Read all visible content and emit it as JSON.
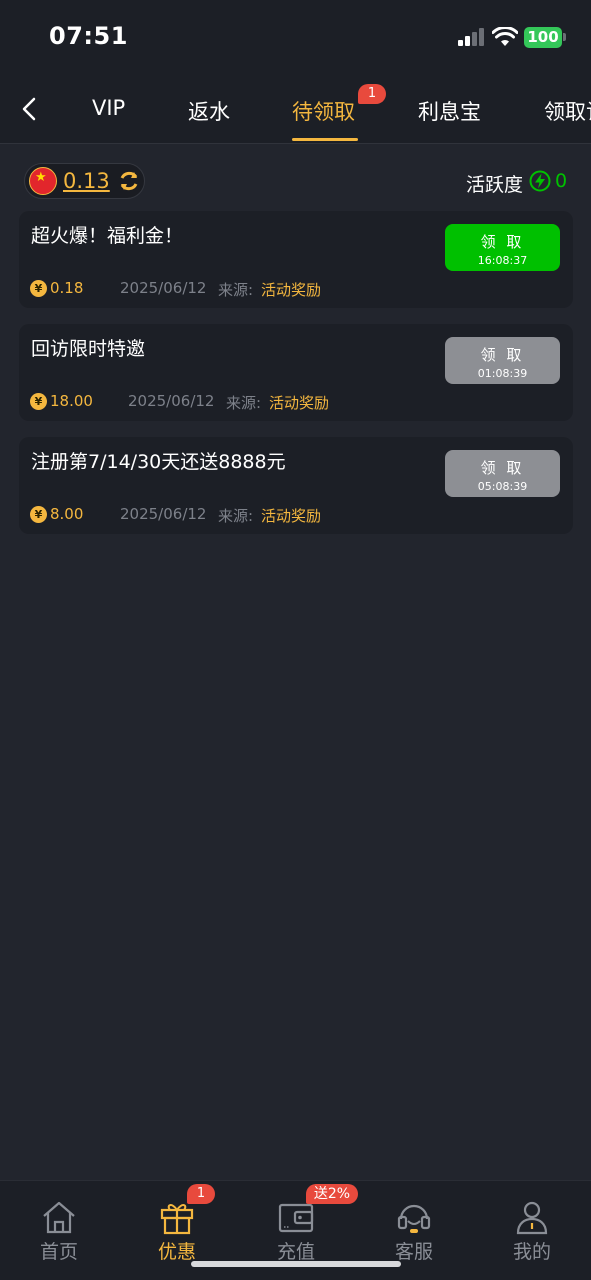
{
  "status_bar": {
    "time": "07:51",
    "battery": "100"
  },
  "nav": {
    "tabs": [
      {
        "label": "VIP"
      },
      {
        "label": "返水"
      },
      {
        "label": "待领取",
        "badge": "1"
      },
      {
        "label": "利息宝"
      },
      {
        "label": "领取记录"
      }
    ],
    "active_tab": "待领取"
  },
  "balance": {
    "amount": "0.13"
  },
  "activity": {
    "label": "活跃度",
    "value": "0"
  },
  "rewards": [
    {
      "title": "超火爆！福利金！",
      "amount": "0.18",
      "date": "2025/06/12",
      "source_label": "来源:",
      "source": "活动奖励",
      "button_label": "领 取",
      "countdown": "16:08:37",
      "state": "active"
    },
    {
      "title": "回访限时特邀",
      "amount": "18.00",
      "date": "2025/06/12",
      "source_label": "来源:",
      "source": "活动奖励",
      "button_label": "领 取",
      "countdown": "01:08:39",
      "state": "disabled"
    },
    {
      "title": "注册第7/14/30天还送8888元",
      "amount": "8.00",
      "date": "2025/06/12",
      "source_label": "来源:",
      "source": "活动奖励",
      "button_label": "领 取",
      "countdown": "05:08:39",
      "state": "disabled"
    }
  ],
  "coin_symbol": "¥",
  "bottom_nav": {
    "items": [
      {
        "label": "首页",
        "icon": "home-icon"
      },
      {
        "label": "优惠",
        "icon": "gift-icon",
        "badge": "1"
      },
      {
        "label": "充值",
        "icon": "wallet-icon",
        "badge": "送2%"
      },
      {
        "label": "客服",
        "icon": "headset-icon"
      },
      {
        "label": "我的",
        "icon": "user-icon"
      }
    ],
    "active": "优惠"
  },
  "colors": {
    "accent": "#f4b73f",
    "green": "#00c000",
    "badge": "#e84a3d",
    "background": "#22252d"
  }
}
